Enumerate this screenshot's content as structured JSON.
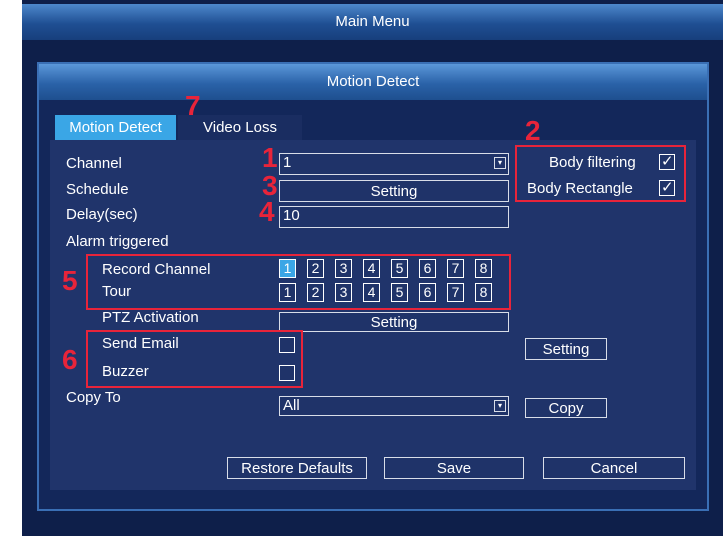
{
  "window": {
    "title": "Main Menu"
  },
  "dialog": {
    "title": "Motion Detect"
  },
  "tabs": [
    {
      "label": "Motion Detect",
      "active": true
    },
    {
      "label": "Video Loss",
      "active": false
    }
  ],
  "form": {
    "channel": {
      "label": "Channel",
      "value": "1"
    },
    "schedule": {
      "label": "Schedule",
      "button": "Setting"
    },
    "delay": {
      "label": "Delay(sec)",
      "value": "10"
    },
    "alarm_triggered": {
      "label": "Alarm triggered"
    },
    "record_channel": {
      "label": "Record Channel",
      "channels": [
        "1",
        "2",
        "3",
        "4",
        "5",
        "6",
        "7",
        "8"
      ],
      "selected": [
        "1"
      ]
    },
    "tour": {
      "label": "Tour",
      "channels": [
        "1",
        "2",
        "3",
        "4",
        "5",
        "6",
        "7",
        "8"
      ],
      "selected": []
    },
    "ptz": {
      "label": "PTZ Activation",
      "button": "Setting"
    },
    "send_email": {
      "label": "Send Email",
      "checked": false,
      "button": "Setting"
    },
    "buzzer": {
      "label": "Buzzer",
      "checked": false
    },
    "copy_to": {
      "label": "Copy To",
      "value": "All",
      "button": "Copy"
    }
  },
  "options": {
    "body_filtering": {
      "label": "Body filtering",
      "checked": true
    },
    "body_rectangle": {
      "label": "Body Rectangle",
      "checked": true
    }
  },
  "footer": {
    "restore": "Restore Defaults",
    "save": "Save",
    "cancel": "Cancel"
  },
  "annotations": {
    "n1": "1",
    "n2": "2",
    "n3": "3",
    "n4": "4",
    "n5": "5",
    "n6": "6",
    "n7": "7"
  },
  "colors": {
    "accent": "#3aa6e6",
    "annotation": "#e8243a",
    "background": "#0e1f4a"
  },
  "icons": {
    "dropdown": "dropdown-arrow-icon",
    "check": "checkmark-icon"
  }
}
